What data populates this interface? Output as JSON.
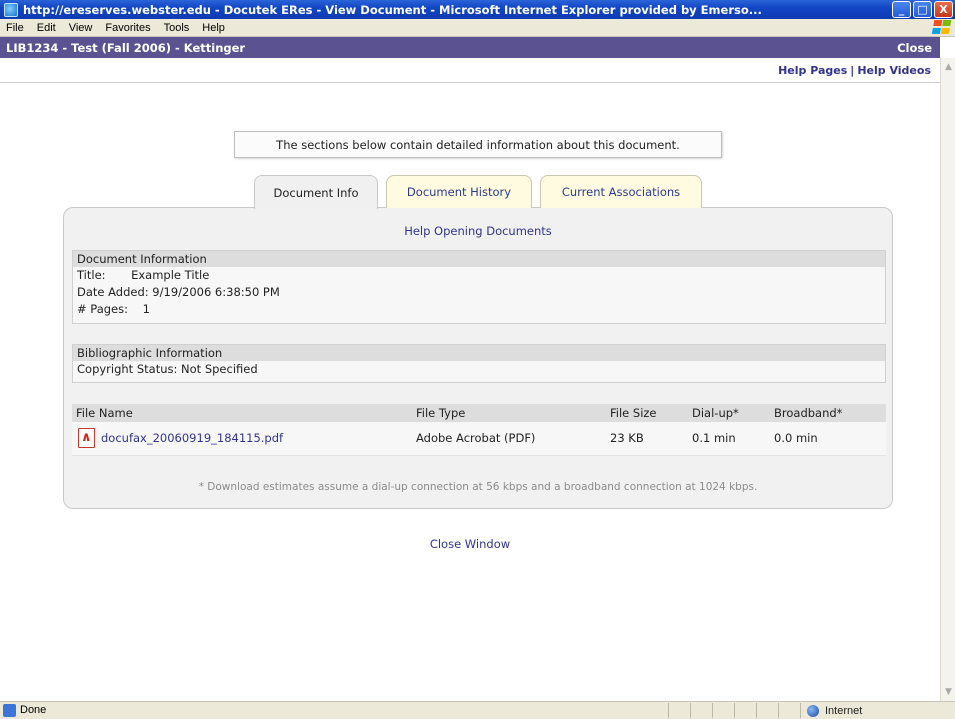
{
  "window": {
    "title": "http://ereserves.webster.edu - Docutek ERes - View Document - Microsoft Internet Explorer provided by Emerso...",
    "buttons": {
      "minimize": "_",
      "maximize": "□",
      "close": "X"
    }
  },
  "menu": {
    "items": [
      "File",
      "Edit",
      "View",
      "Favorites",
      "Tools",
      "Help"
    ]
  },
  "header": {
    "course": "LIB1234 - Test (Fall 2006) - Kettinger",
    "close_label": "Close",
    "help_pages": "Help Pages",
    "separator": "|",
    "help_videos": "Help Videos"
  },
  "info_note": "The sections below contain detailed information about this document.",
  "tabs": [
    {
      "label": "Document Info",
      "active": true
    },
    {
      "label": "Document History",
      "active": false
    },
    {
      "label": "Current Associations",
      "active": false
    }
  ],
  "panel": {
    "help_opening": "Help Opening Documents",
    "doc_section": {
      "heading": "Document Information",
      "title_row": "Title:       Example Title",
      "date_row": "Date Added: 9/19/2006 6:38:50 PM",
      "pages_row": "# Pages:    1"
    },
    "bib_section": {
      "heading": "Bibliographic Information",
      "copyright_row": "Copyright Status: Not Specified"
    },
    "files": {
      "columns": [
        "File Name",
        "File Type",
        "File Size",
        "Dial-up*",
        "Broadband*"
      ],
      "rows": [
        {
          "name": "docufax_20060919_184115.pdf",
          "type": "Adobe Acrobat (PDF)",
          "size": "23 KB",
          "dialup": "0.1 min",
          "broadband": "0.0 min"
        }
      ]
    },
    "footnote": "* Download estimates assume a dial-up connection at 56 kbps and a broadband connection at 1024 kbps."
  },
  "close_window": "Close Window",
  "status": {
    "text": "Done",
    "zone": "Internet"
  },
  "colors": {
    "course_band": "#5b5391",
    "link": "#33338f",
    "tab_inactive": "#fffbe0"
  }
}
